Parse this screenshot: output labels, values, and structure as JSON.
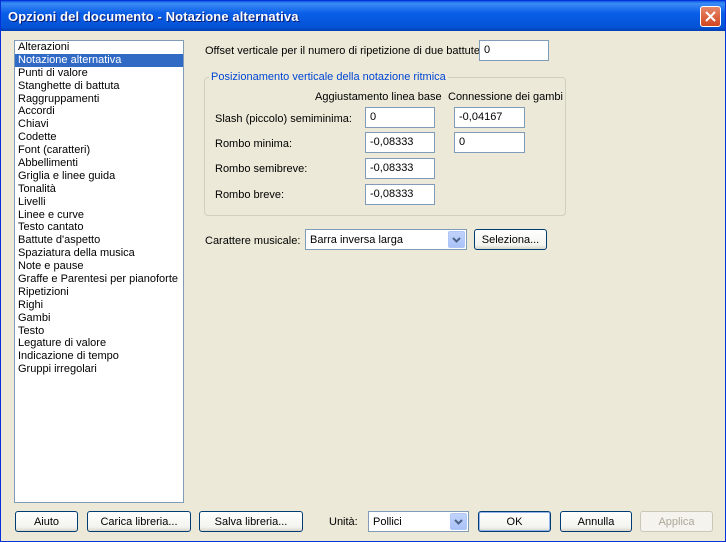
{
  "window": {
    "title": "Opzioni del documento - Notazione alternativa"
  },
  "sidebar": {
    "items": [
      "Alterazioni",
      "Notazione alternativa",
      "Punti di valore",
      "Stanghette di battuta",
      "Raggruppamenti",
      "Accordi",
      "Chiavi",
      "Codette",
      "Font (caratteri)",
      "Abbellimenti",
      "Griglia e linee guida",
      "Tonalità",
      "Livelli",
      "Linee e curve",
      "Testo cantato",
      "Battute d'aspetto",
      "Spaziatura della musica",
      "Note e pause",
      "Graffe e Parentesi per pianoforte",
      "Ripetizioni",
      "Righi",
      "Gambi",
      "Testo",
      "Legature di valore",
      "Indicazione di tempo",
      "Gruppi irregolari"
    ],
    "selected": "Notazione alternativa"
  },
  "offset": {
    "label": "Offset verticale per il numero di ripetizione di due battute:",
    "value": "0"
  },
  "group": {
    "title": "Posizionamento verticale della notazione ritmica",
    "col1_header": "Aggiustamento linea base",
    "col2_header": "Connessione dei gambi",
    "rows": [
      {
        "label": "Slash (piccolo) semiminima:",
        "baseline": "0",
        "stem": "-0,04167"
      },
      {
        "label": "Rombo minima:",
        "baseline": "-0,08333",
        "stem": "0"
      },
      {
        "label": "Rombo semibreve:",
        "baseline": "-0,08333"
      },
      {
        "label": "Rombo breve:",
        "baseline": "-0,08333"
      }
    ]
  },
  "font": {
    "label": "Carattere musicale:",
    "value": "Barra inversa larga",
    "select_button": "Seleziona..."
  },
  "footer": {
    "help": "Aiuto",
    "load_library": "Carica libreria...",
    "save_library": "Salva libreria...",
    "units_label": "Unità:",
    "units_value": "Pollici",
    "ok": "OK",
    "cancel": "Annulla",
    "apply": "Applica"
  }
}
